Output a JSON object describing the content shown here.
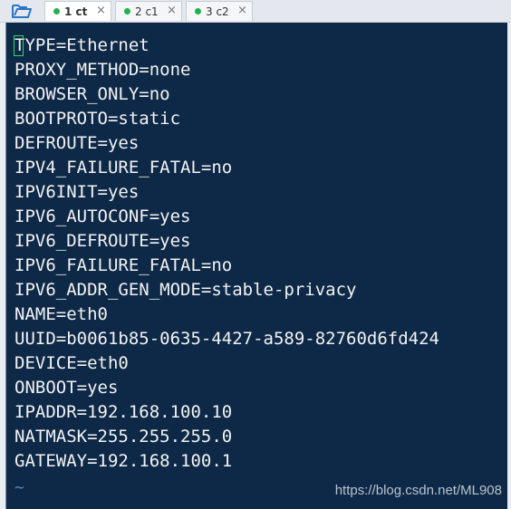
{
  "tabs": [
    {
      "label": "1 ct",
      "active": true,
      "dot_color": "#22b14c",
      "close": "×"
    },
    {
      "label": "2 c1",
      "active": false,
      "dot_color": "#22b14c",
      "close": "×"
    },
    {
      "label": "3 c2",
      "active": false,
      "dot_color": "#22b14c",
      "close": "×"
    }
  ],
  "terminal": {
    "lines": [
      "TYPE=Ethernet",
      "PROXY_METHOD=none",
      "BROWSER_ONLY=no",
      "BOOTPROTO=static",
      "DEFROUTE=yes",
      "IPV4_FAILURE_FATAL=no",
      "IPV6INIT=yes",
      "IPV6_AUTOCONF=yes",
      "IPV6_DEFROUTE=yes",
      "IPV6_FAILURE_FATAL=no",
      "IPV6_ADDR_GEN_MODE=stable-privacy",
      "NAME=eth0",
      "UUID=b0061b85-0635-4427-a589-82760d6fd424",
      "DEVICE=eth0",
      "ONBOOT=yes",
      "IPADDR=192.168.100.10",
      "NATMASK=255.255.255.0",
      "GATEWAY=192.168.100.1"
    ],
    "empty_line_marker": "~",
    "background": "#0e2947",
    "cursor_color": "#2fd66a"
  },
  "watermark": "https://blog.csdn.net/ML908",
  "icons": {
    "folder": "open-folder-icon"
  }
}
